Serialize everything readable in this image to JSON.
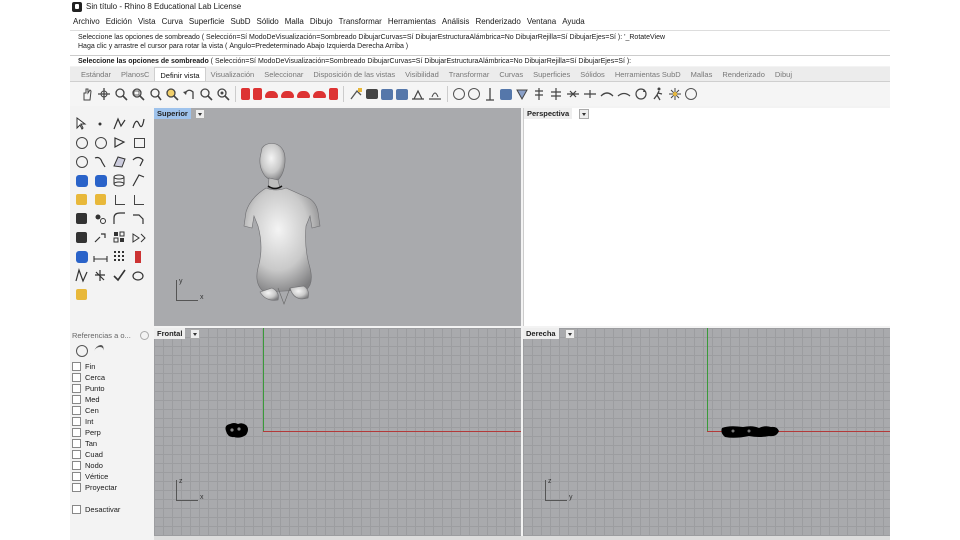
{
  "window": {
    "title": "Sin título - Rhino 8 Educational Lab License"
  },
  "menu": [
    "Archivo",
    "Edición",
    "Vista",
    "Curva",
    "Superficie",
    "SubD",
    "Sólido",
    "Malla",
    "Dibujo",
    "Transformar",
    "Herramientas",
    "Análisis",
    "Renderizado",
    "Ventana",
    "Ayuda"
  ],
  "command": {
    "history": [
      "Seleccione las opciones de sombreado ( Selección=Sí  ModoDeVisualización=Sombreado  DibujarCurvas=Sí  DibujarEstructuraAlámbrica=No  DibujarRejilla=Sí  DibujarEjes=Sí ): '_RotateView",
      "Haga clic y arrastre el cursor para rotar la vista ( Ángulo=Predeterminado  Abajo  Izquierda  Derecha  Arriba )"
    ],
    "prompt_bold": "Seleccione las opciones de sombreado",
    "prompt_rest": " ( Selección=Sí  ModoDeVisualización=Sombreado  DibujarCurvas=Sí  DibujarEstructuraAlámbrica=No  DibujarRejilla=Sí  DibujarEjes=Sí ):"
  },
  "tabs": [
    "Estándar",
    "PlanosC",
    "Definir vista",
    "Visualización",
    "Seleccionar",
    "Disposición de las vistas",
    "Visibilidad",
    "Transformar",
    "Curvas",
    "Superficies",
    "Sólidos",
    "Herramientas SubD",
    "Mallas",
    "Renderizado",
    "Dibuj"
  ],
  "active_tab": "Definir vista",
  "viewports": {
    "top": {
      "label": "Superior"
    },
    "perspective": {
      "label": "Perspectiva"
    },
    "front": {
      "label": "Frontal"
    },
    "right": {
      "label": "Derecha"
    }
  },
  "axis_labels": {
    "y": "y",
    "x": "x",
    "z": "z"
  },
  "osnap": {
    "title": "Referencias a o...",
    "items": [
      "Fin",
      "Cerca",
      "Punto",
      "Med",
      "Cen",
      "Int",
      "Perp",
      "Tan",
      "Cuad",
      "Nodo",
      "Vértice",
      "Proyectar"
    ],
    "disable": "Desactivar"
  },
  "colors": {
    "x_axis": "#b33a3a",
    "y_axis": "#3a9a3a",
    "active_viewport": "#9fc3ec",
    "viewport_bg": "#a9aaad"
  }
}
